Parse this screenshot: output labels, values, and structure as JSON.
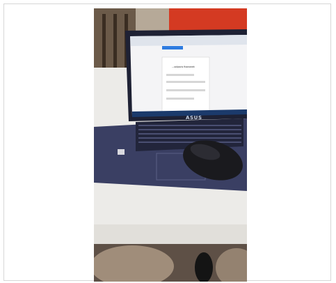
{
  "photo": {
    "laptop_logo_text": "ASUS",
    "screen_form_title": "...ualpacis fixonanek"
  },
  "colors": {
    "page_bg": "#ffffff",
    "frame_border": "#d7d7d7",
    "laptop_body": "#3a3f63",
    "screen_bg": "#f4f4f6",
    "mouse": "#1a1a1e",
    "desk": "#ecebe8",
    "wall_red": "#d43a22"
  }
}
